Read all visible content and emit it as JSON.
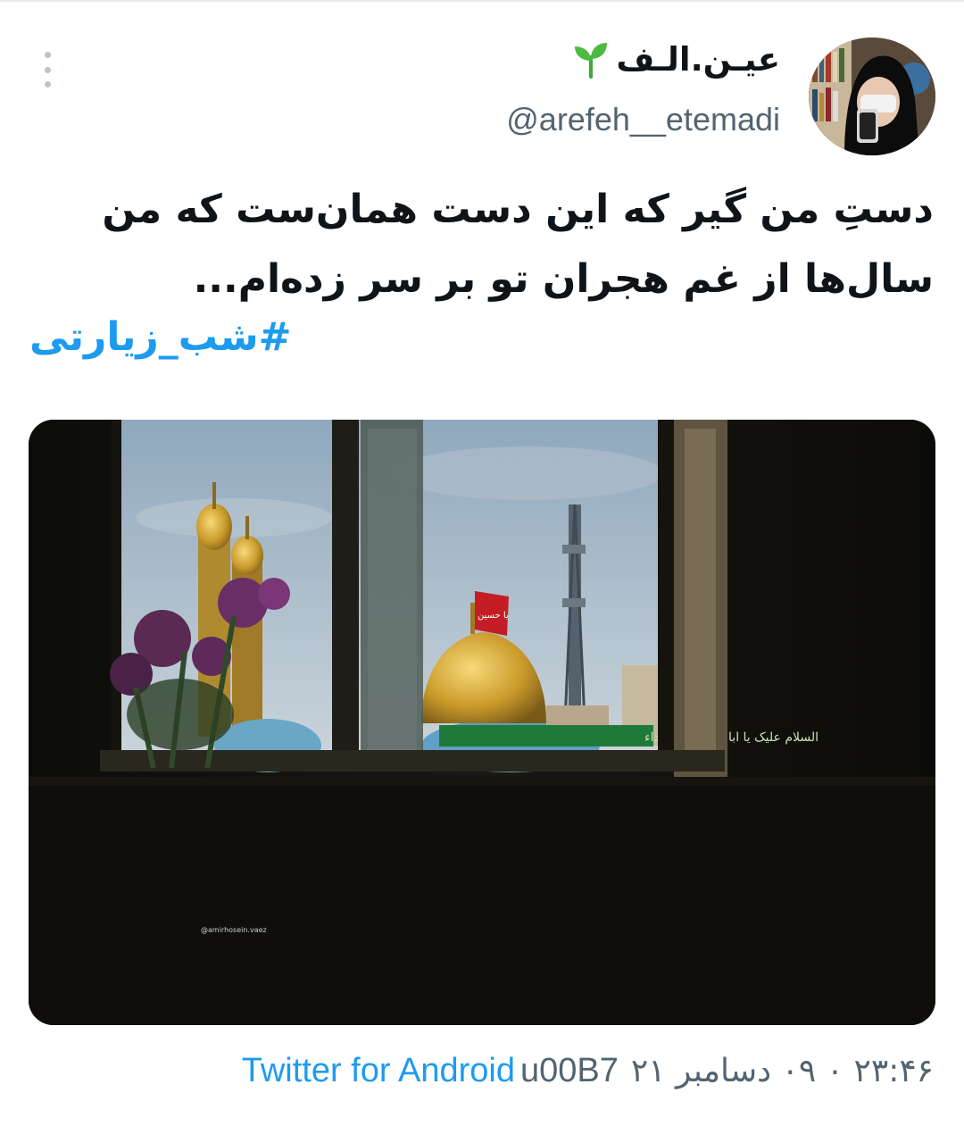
{
  "user": {
    "display_name": "عیـن.الـف",
    "handle": "@arefeh__etemadi",
    "badge_icon": "sprout-icon"
  },
  "tweet": {
    "lines": [
      "دستِ من گیر که این دست همان‌ست که من",
      "سال‌ها از غم هجران تو بر سر زده‌ام..."
    ],
    "hashtag": "#شب_زیارتی"
  },
  "media": {
    "flag_text": "یا حسین",
    "banner_text": "السلام علیک یا ابا عبدالله الشهداء",
    "watermark": "@amirhosein.vaez"
  },
  "meta": {
    "timestamp": "۲۳:۴۶ ۰ ۰۹ دسامبر ۲۱",
    "separator": "u00B7",
    "source": "Twitter for Android"
  },
  "colors": {
    "accent": "#1d9bf0",
    "text": "#0f1419",
    "secondary": "#536471"
  }
}
